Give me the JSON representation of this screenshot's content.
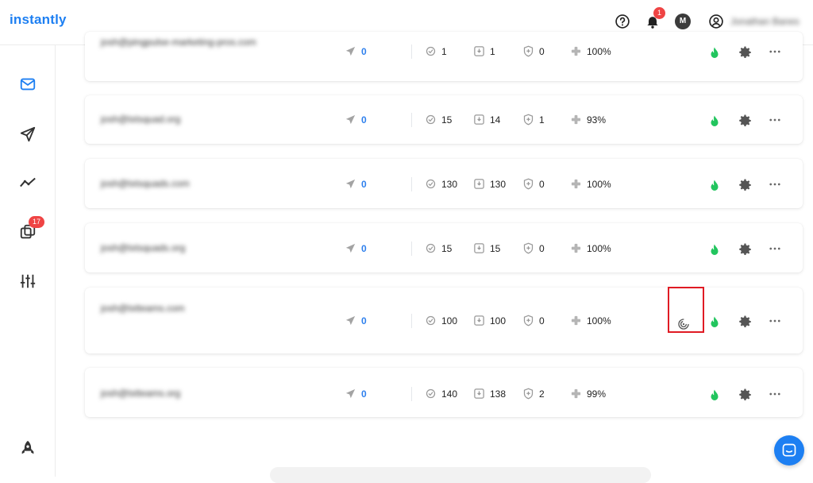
{
  "app": {
    "logo": "instantly",
    "brand_color": "#1d7ff2"
  },
  "header": {
    "notification_count": "1",
    "avatar_initial": "M",
    "user_name": "Jonathan Banes"
  },
  "sidebar": {
    "items": [
      {
        "name": "mail",
        "icon": "mail-icon",
        "active": true
      },
      {
        "name": "campaigns",
        "icon": "send-icon"
      },
      {
        "name": "analytics",
        "icon": "trend-icon"
      },
      {
        "name": "unibox",
        "icon": "layers-icon",
        "badge": "17"
      },
      {
        "name": "settings",
        "icon": "sliders-icon"
      }
    ],
    "bottom_icon": "rocket-icon"
  },
  "accounts": [
    {
      "email": "josh@pingpulse-marketing-pros.com",
      "sent": "0",
      "warmup_sent": "1",
      "received": "1",
      "protected": "0",
      "health": "100%",
      "highlighted": false
    },
    {
      "email": "josh@txtsquad.org",
      "sent": "0",
      "warmup_sent": "15",
      "received": "14",
      "protected": "1",
      "health": "93%",
      "highlighted": false
    },
    {
      "email": "josh@txtsquads.com",
      "sent": "0",
      "warmup_sent": "130",
      "received": "130",
      "protected": "0",
      "health": "100%",
      "highlighted": false
    },
    {
      "email": "josh@txtsquads.org",
      "sent": "0",
      "warmup_sent": "15",
      "received": "15",
      "protected": "0",
      "health": "100%",
      "highlighted": false
    },
    {
      "email": "josh@txtteams.com",
      "sent": "0",
      "warmup_sent": "100",
      "received": "100",
      "protected": "0",
      "health": "100%",
      "highlighted": true
    },
    {
      "email": "josh@txtteams.org",
      "sent": "0",
      "warmup_sent": "140",
      "received": "138",
      "protected": "2",
      "health": "99%",
      "highlighted": false
    }
  ],
  "colors": {
    "warmup_green": "#22c55e",
    "badge_red": "#ef4444",
    "highlight_red": "#e01b24"
  }
}
